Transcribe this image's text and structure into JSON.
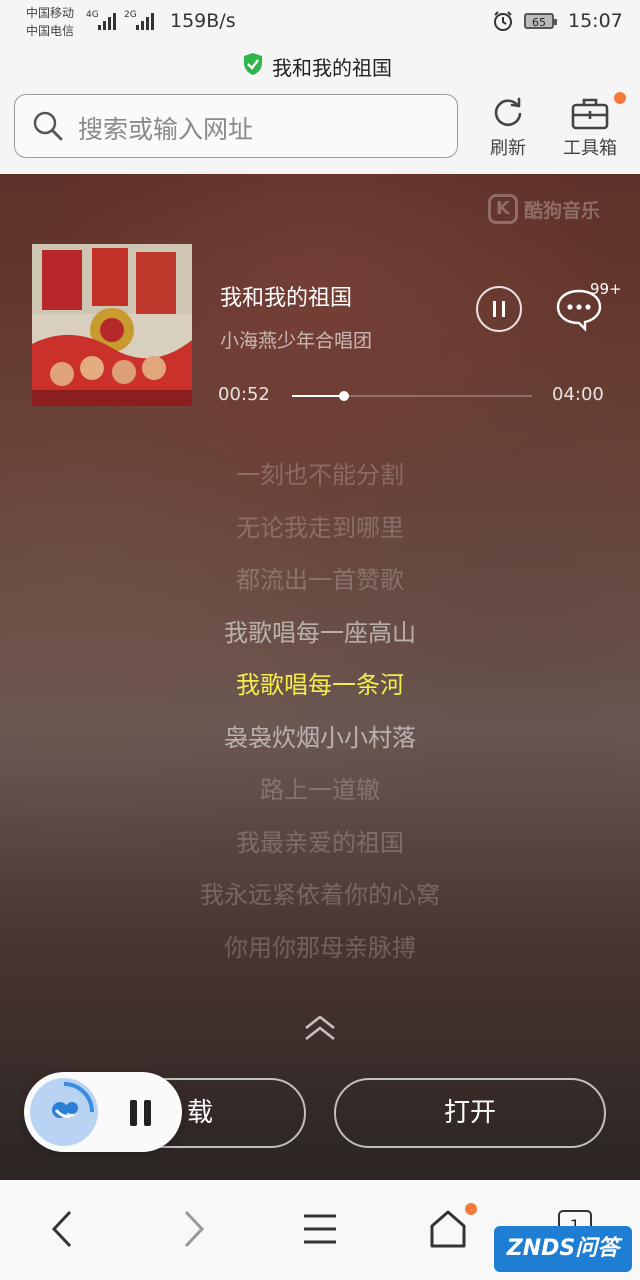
{
  "status_bar": {
    "carrier_1": "中国移动",
    "carrier_2": "中国电信",
    "net_1": "4G",
    "net_2": "2G",
    "speed": "159B/s",
    "battery": "65",
    "time": "15:07"
  },
  "page": {
    "title": "我和我的祖国"
  },
  "search": {
    "placeholder": "搜索或输入网址"
  },
  "toolbar": {
    "refresh_label": "刷新",
    "tools_label": "工具箱"
  },
  "player": {
    "watermark": "酷狗音乐",
    "watermark_mark": "K",
    "song_title": "我和我的祖国",
    "artist": "小海燕少年合唱团",
    "comment_count": "99+",
    "current_time": "00:52",
    "total_time": "04:00",
    "progress": 0.217
  },
  "lyrics": [
    "一刻也不能分割",
    "无论我走到哪里",
    "都流出一首赞歌",
    "我歌唱每一座高山",
    "我歌唱每一条河",
    "袅袅炊烟小小村落",
    "路上一道辙",
    "我最亲爱的祖国",
    "我永远紧依着你的心窝",
    "你用你那母亲脉搏"
  ],
  "active_lyric_index": 4,
  "actions": {
    "download_label": "载",
    "open_label": "打开"
  },
  "bottom_nav": {
    "tab_count": "1",
    "badge": "ZNDS问答"
  },
  "colors": {
    "active_lyric": "#f3ee4a",
    "accent_dot": "#f47a3b",
    "shield": "#2fb54a"
  }
}
